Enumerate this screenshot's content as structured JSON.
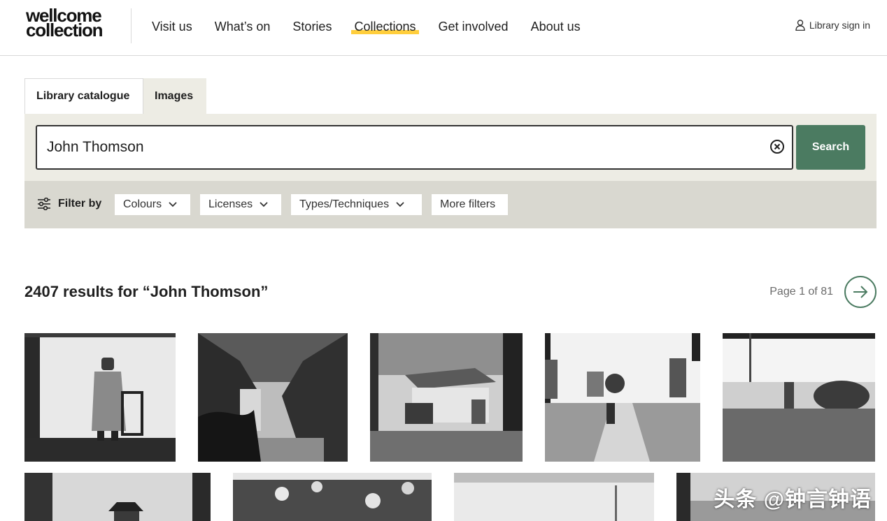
{
  "header": {
    "logo_line1": "wellcome",
    "logo_line2": "collection",
    "nav": [
      "Visit us",
      "What’s on",
      "Stories",
      "Collections",
      "Get involved",
      "About us"
    ],
    "active_nav": "Collections",
    "signin_label": "Library sign in",
    "accent_color": "#ffce3c"
  },
  "tabs": {
    "library": "Library catalogue",
    "images": "Images"
  },
  "search": {
    "value": "John Thomson",
    "button_label": "Search",
    "button_color": "#4b7b61"
  },
  "filters": {
    "label": "Filter by",
    "colours": "Colours",
    "licenses": "Licenses",
    "types": "Types/Techniques",
    "more": "More filters"
  },
  "results": {
    "heading": "2407 results for “John Thomson”",
    "page_label": "Page 1 of 81"
  },
  "images": [
    "portrait-standing-figure",
    "large-tree",
    "house-with-donkey",
    "road-with-pagodas",
    "bowl-and-figure",
    "seated-figure-hat",
    "flowering-shrubs",
    "faded-landscape",
    "blurred-scene"
  ],
  "watermark": "头条 @钟言钟语"
}
